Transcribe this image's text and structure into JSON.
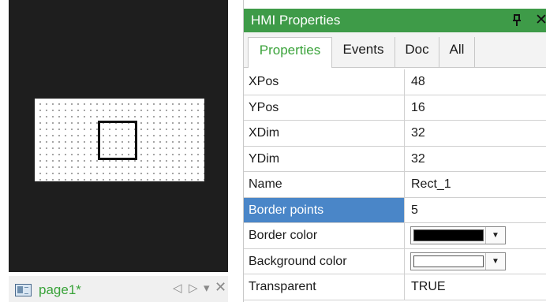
{
  "canvas": {
    "page_tab": {
      "label": "page1*"
    },
    "tab_controls": {
      "prev": "◁",
      "next": "▷",
      "menu": "▾",
      "close": "✕"
    }
  },
  "properties_panel": {
    "title": "HMI Properties",
    "pin_glyph": "ꟼ",
    "close_glyph": "✕",
    "tabs": [
      {
        "label": "Properties",
        "active": true
      },
      {
        "label": "Events",
        "active": false
      },
      {
        "label": "Doc",
        "active": false
      },
      {
        "label": "All",
        "active": false
      }
    ],
    "rows": [
      {
        "name": "XPos",
        "value": "48"
      },
      {
        "name": "YPos",
        "value": "16"
      },
      {
        "name": "XDim",
        "value": "32"
      },
      {
        "name": "YDim",
        "value": "32"
      },
      {
        "name": "Name",
        "value": "Rect_1"
      },
      {
        "name": "Border points",
        "value": "5",
        "selected": true
      },
      {
        "name": "Border color",
        "color": "#000000"
      },
      {
        "name": "Background color",
        "color": "#ffffff"
      },
      {
        "name": "Transparent",
        "value": "TRUE"
      }
    ]
  },
  "colors": {
    "titlebar": "#3e9b48",
    "active_tab_text": "#3aa33a",
    "selection": "#4a86c8",
    "canvas_bg": "#1e1e1e"
  }
}
